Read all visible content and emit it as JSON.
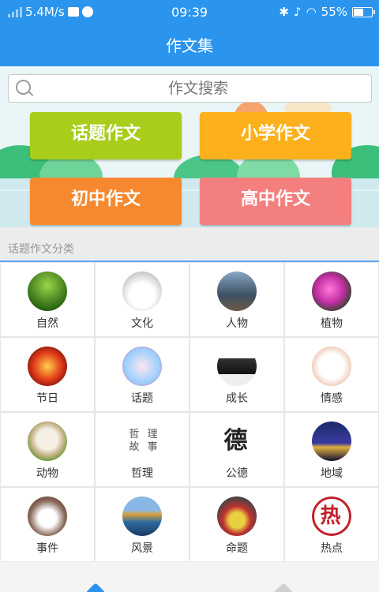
{
  "status_bar": {
    "speed": "5.4M/s",
    "time": "09:39",
    "battery": "55%",
    "battery_level": 0.55
  },
  "header": {
    "title": "作文集"
  },
  "search": {
    "placeholder": "作文搜索"
  },
  "categories": [
    {
      "label": "话题作文",
      "color": "#a8cd1b"
    },
    {
      "label": "小学作文",
      "color": "#fbb01c"
    },
    {
      "label": "初中作文",
      "color": "#f6892f"
    },
    {
      "label": "高中作文",
      "color": "#f47f7f"
    }
  ],
  "section": {
    "label": "话题作文分类"
  },
  "topics": [
    {
      "label": "自然",
      "icon": "grass-icon"
    },
    {
      "label": "文化",
      "icon": "culture-icon"
    },
    {
      "label": "人物",
      "icon": "person-icon"
    },
    {
      "label": "植物",
      "icon": "flower-icon"
    },
    {
      "label": "节日",
      "icon": "lantern-icon"
    },
    {
      "label": "话题",
      "icon": "chat-icon"
    },
    {
      "label": "成长",
      "icon": "people-icon"
    },
    {
      "label": "情感",
      "icon": "fingers-icon"
    },
    {
      "label": "动物",
      "icon": "puppy-icon"
    },
    {
      "label": "哲理",
      "icon": "philosophy-icon",
      "thumb_text": "哲 理 故 事"
    },
    {
      "label": "公德",
      "icon": "virtue-icon",
      "thumb_text": "德"
    },
    {
      "label": "地域",
      "icon": "city-icon"
    },
    {
      "label": "事件",
      "icon": "writing-icon"
    },
    {
      "label": "风景",
      "icon": "landscape-icon"
    },
    {
      "label": "命题",
      "icon": "pencils-icon"
    },
    {
      "label": "热点",
      "icon": "hot-icon",
      "thumb_text": "热"
    }
  ]
}
